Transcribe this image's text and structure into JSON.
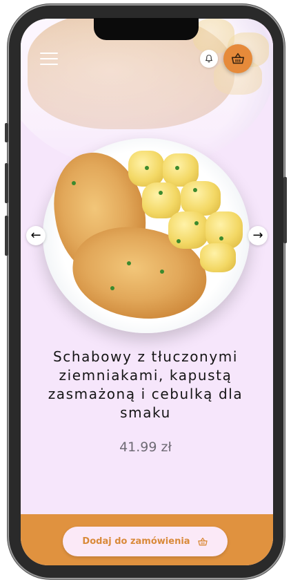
{
  "header": {
    "menu_icon": "hamburger-menu-icon",
    "notification_icon": "bell-icon",
    "cart_icon": "basket-icon"
  },
  "carousel": {
    "prev_icon": "arrow-left-icon",
    "next_icon": "arrow-right-icon",
    "prev_glyph": "←",
    "next_glyph": "→",
    "dish_image": "schnitzel-with-potatoes-image"
  },
  "product": {
    "title": "Schabowy z tłuczonymi ziemniakami, kapustą zasmażoną i cebulką dla smaku",
    "price": "41.99 zł"
  },
  "order": {
    "button_label": "Dodaj do zamówienia",
    "button_icon": "basket-icon"
  },
  "colors": {
    "background": "#f6e6fb",
    "accent": "#e68a3a",
    "button_bg": "#fbe9f7",
    "button_text": "#d98a3a"
  }
}
